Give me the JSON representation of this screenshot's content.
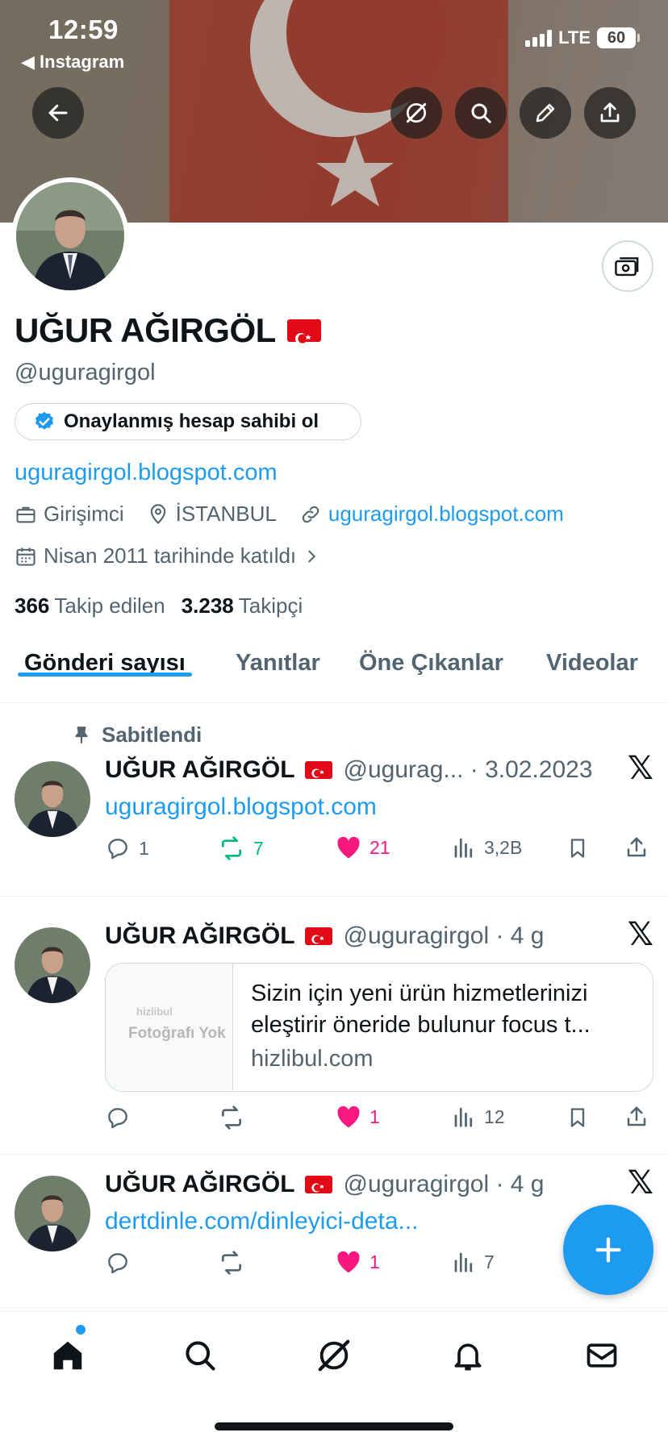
{
  "status_bar": {
    "time": "12:59",
    "back_app": "◀ Instagram",
    "network": "LTE",
    "battery": "60"
  },
  "header": {
    "icons": [
      "back-arrow-icon",
      "grok-icon",
      "search-icon",
      "edit-icon",
      "share-icon"
    ]
  },
  "profile": {
    "name": "UĞUR AĞIRGÖL",
    "handle": "@uguragirgol",
    "verify_cta": "Onaylanmış hesap sahibi ol",
    "bio_link": "uguragirgol.blogspot.com",
    "category": "Girişimci",
    "location": "İSTANBUL",
    "website": "uguragirgol.blogspot.com",
    "joined": "Nisan 2011 tarihinde katıldı",
    "following_count": "366",
    "following_label": "Takip edilen",
    "followers_count": "3.238",
    "followers_label": "Takipçi"
  },
  "tabs": [
    "Gönderi sayısı",
    "Yanıtlar",
    "Öne Çıkanlar",
    "Videolar"
  ],
  "colors": {
    "accent": "#1d9bf0",
    "retweet": "#00ba7c",
    "like": "#f91880",
    "secondary_text": "#536471"
  },
  "posts": [
    {
      "pinned_label": "Sabitlendi",
      "name": "UĞUR AĞIRGÖL",
      "handle_time": "@ugurag... · 3.02.2023",
      "text": "uguragirgol.blogspot.com",
      "replies": "1",
      "retweets": "7",
      "likes": "21",
      "views": "3,2B"
    },
    {
      "name": "UĞUR AĞIRGÖL",
      "handle_time": "@uguragirgol · 4 g",
      "card_brand": "hizlibul",
      "card_no_photo": "Fotoğrafı Yok",
      "card_title": "Sizin için yeni ürün hizmetlerinizi eleştirir öneride bulunur focus t...",
      "card_domain": "hizlibul.com",
      "likes": "1",
      "views": "12"
    },
    {
      "name": "UĞUR AĞIRGÖL",
      "handle_time": "@uguragirgol · 4 g",
      "text": "dertdinle.com/dinleyici-deta...",
      "likes": "1",
      "views": "7"
    }
  ]
}
